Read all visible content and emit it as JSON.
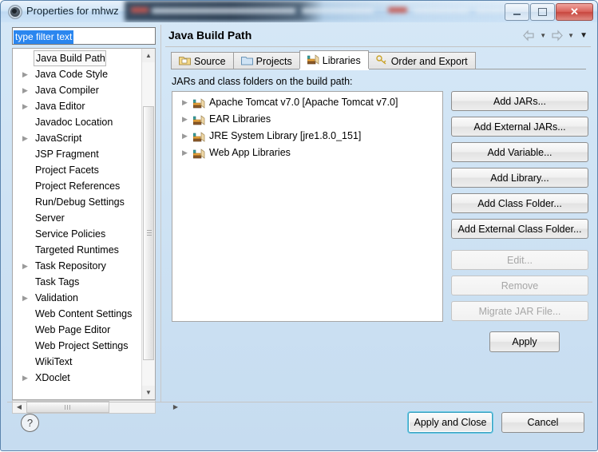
{
  "window": {
    "title": "Properties for mhwz",
    "icon": "eclipse-icon",
    "controls": {
      "minimize": "minimize",
      "maximize": "maximize",
      "close": "close"
    }
  },
  "sidebar": {
    "filter": {
      "value": "type filter text",
      "placeholder": "type filter text"
    },
    "items": [
      {
        "label": "Java Build Path",
        "expandable": false,
        "selected": true
      },
      {
        "label": "Java Code Style",
        "expandable": true,
        "selected": false
      },
      {
        "label": "Java Compiler",
        "expandable": true,
        "selected": false
      },
      {
        "label": "Java Editor",
        "expandable": true,
        "selected": false
      },
      {
        "label": "Javadoc Location",
        "expandable": false,
        "selected": false
      },
      {
        "label": "JavaScript",
        "expandable": true,
        "selected": false
      },
      {
        "label": "JSP Fragment",
        "expandable": false,
        "selected": false
      },
      {
        "label": "Project Facets",
        "expandable": false,
        "selected": false
      },
      {
        "label": "Project References",
        "expandable": false,
        "selected": false
      },
      {
        "label": "Run/Debug Settings",
        "expandable": false,
        "selected": false
      },
      {
        "label": "Server",
        "expandable": false,
        "selected": false
      },
      {
        "label": "Service Policies",
        "expandable": false,
        "selected": false
      },
      {
        "label": "Targeted Runtimes",
        "expandable": false,
        "selected": false
      },
      {
        "label": "Task Repository",
        "expandable": true,
        "selected": false
      },
      {
        "label": "Task Tags",
        "expandable": false,
        "selected": false
      },
      {
        "label": "Validation",
        "expandable": true,
        "selected": false
      },
      {
        "label": "Web Content Settings",
        "expandable": false,
        "selected": false
      },
      {
        "label": "Web Page Editor",
        "expandable": false,
        "selected": false
      },
      {
        "label": "Web Project Settings",
        "expandable": false,
        "selected": false
      },
      {
        "label": "WikiText",
        "expandable": false,
        "selected": false
      },
      {
        "label": "XDoclet",
        "expandable": true,
        "selected": false
      }
    ]
  },
  "page": {
    "title": "Java Build Path",
    "nav": {
      "back": "back-arrow",
      "forward": "forward-arrow",
      "menu": "dropdown-arrow"
    },
    "tabs": [
      {
        "label": "Source",
        "icon": "source-folder-icon",
        "active": false
      },
      {
        "label": "Projects",
        "icon": "projects-folder-icon",
        "active": false
      },
      {
        "label": "Libraries",
        "icon": "libraries-books-icon",
        "active": true
      },
      {
        "label": "Order and Export",
        "icon": "order-export-key-icon",
        "active": false
      }
    ],
    "list_label": "JARs and class folders on the build path:",
    "libraries": [
      {
        "label": "Apache Tomcat v7.0 [Apache Tomcat v7.0]",
        "icon": "library-books-icon"
      },
      {
        "label": "EAR Libraries",
        "icon": "library-books-icon"
      },
      {
        "label": "JRE System Library [jre1.8.0_151]",
        "icon": "library-books-icon"
      },
      {
        "label": "Web App Libraries",
        "icon": "library-books-icon"
      }
    ],
    "buttons": [
      {
        "label": "Add JARs...",
        "enabled": true
      },
      {
        "label": "Add External JARs...",
        "enabled": true
      },
      {
        "label": "Add Variable...",
        "enabled": true
      },
      {
        "label": "Add Library...",
        "enabled": true
      },
      {
        "label": "Add Class Folder...",
        "enabled": true
      },
      {
        "label": "Add External Class Folder...",
        "enabled": true
      },
      {
        "label": "Edit...",
        "enabled": false
      },
      {
        "label": "Remove",
        "enabled": false
      },
      {
        "label": "Migrate JAR File...",
        "enabled": false
      }
    ],
    "apply_label": "Apply"
  },
  "footer": {
    "help": "?",
    "apply_and_close": "Apply and Close",
    "cancel": "Cancel"
  },
  "colors": {
    "title_bar": "#cde3f7",
    "selection_blue": "#2a86ef",
    "default_focus": "#63c8e4",
    "close_red": "#c8463e",
    "dialog_bg": "#cfe3f4"
  }
}
